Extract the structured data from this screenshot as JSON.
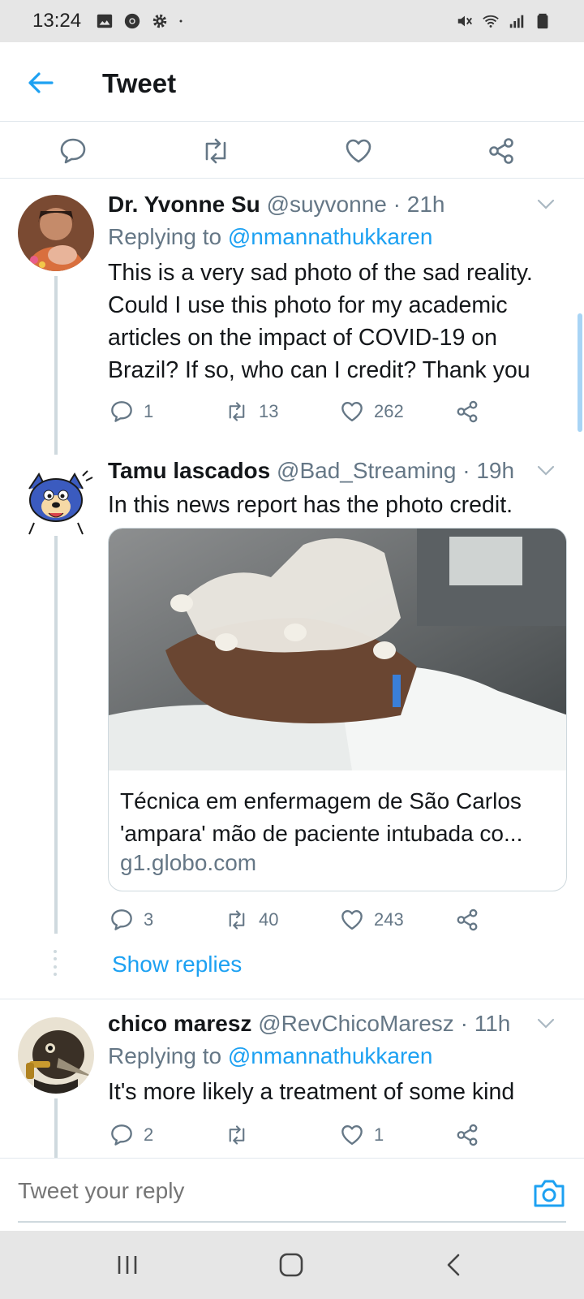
{
  "status_bar": {
    "time": "13:24",
    "icons": [
      "gallery-icon",
      "chrome-icon",
      "settings-icon",
      "dot-icon",
      "mute-icon",
      "wifi-icon",
      "signal-icon",
      "battery-icon"
    ]
  },
  "header": {
    "title": "Tweet"
  },
  "colors": {
    "accent": "#1da1f2",
    "muted": "#657786",
    "text": "#14171a",
    "border": "#e1e8ed"
  },
  "tweets": [
    {
      "name": "Dr. Yvonne Su",
      "handle": "@suyvonne",
      "time": "21h",
      "replying_label": "Replying to",
      "replying_to": "@nmannathukkaren",
      "text": "This is a very sad photo of the sad reality. Could I use this photo for my academic articles on the impact of COVID-19 on Brazil? If so, who can I credit? Thank you",
      "replies": "1",
      "retweets": "13",
      "likes": "262"
    },
    {
      "name": "Tamu lascados",
      "handle": "@Bad_Streaming",
      "time": "19h",
      "text": "In this news report has the photo credit.",
      "card": {
        "title": "Técnica em enfermagem de São Carlos 'ampara' mão de paciente intubada co...",
        "domain": "g1.globo.com"
      },
      "replies": "3",
      "retweets": "40",
      "likes": "243",
      "show_replies": "Show replies"
    },
    {
      "name": "chico maresz",
      "handle": "@RevChicoMaresz",
      "time": "11h",
      "replying_label": "Replying to",
      "replying_to": "@nmannathukkaren",
      "text": "It's more likely a treatment of some kind",
      "replies": "2",
      "retweets": "",
      "likes": "1"
    }
  ],
  "reply_bar": {
    "placeholder": "Tweet your reply"
  },
  "nav": [
    "recent-apps-icon",
    "home-icon",
    "back-icon"
  ]
}
